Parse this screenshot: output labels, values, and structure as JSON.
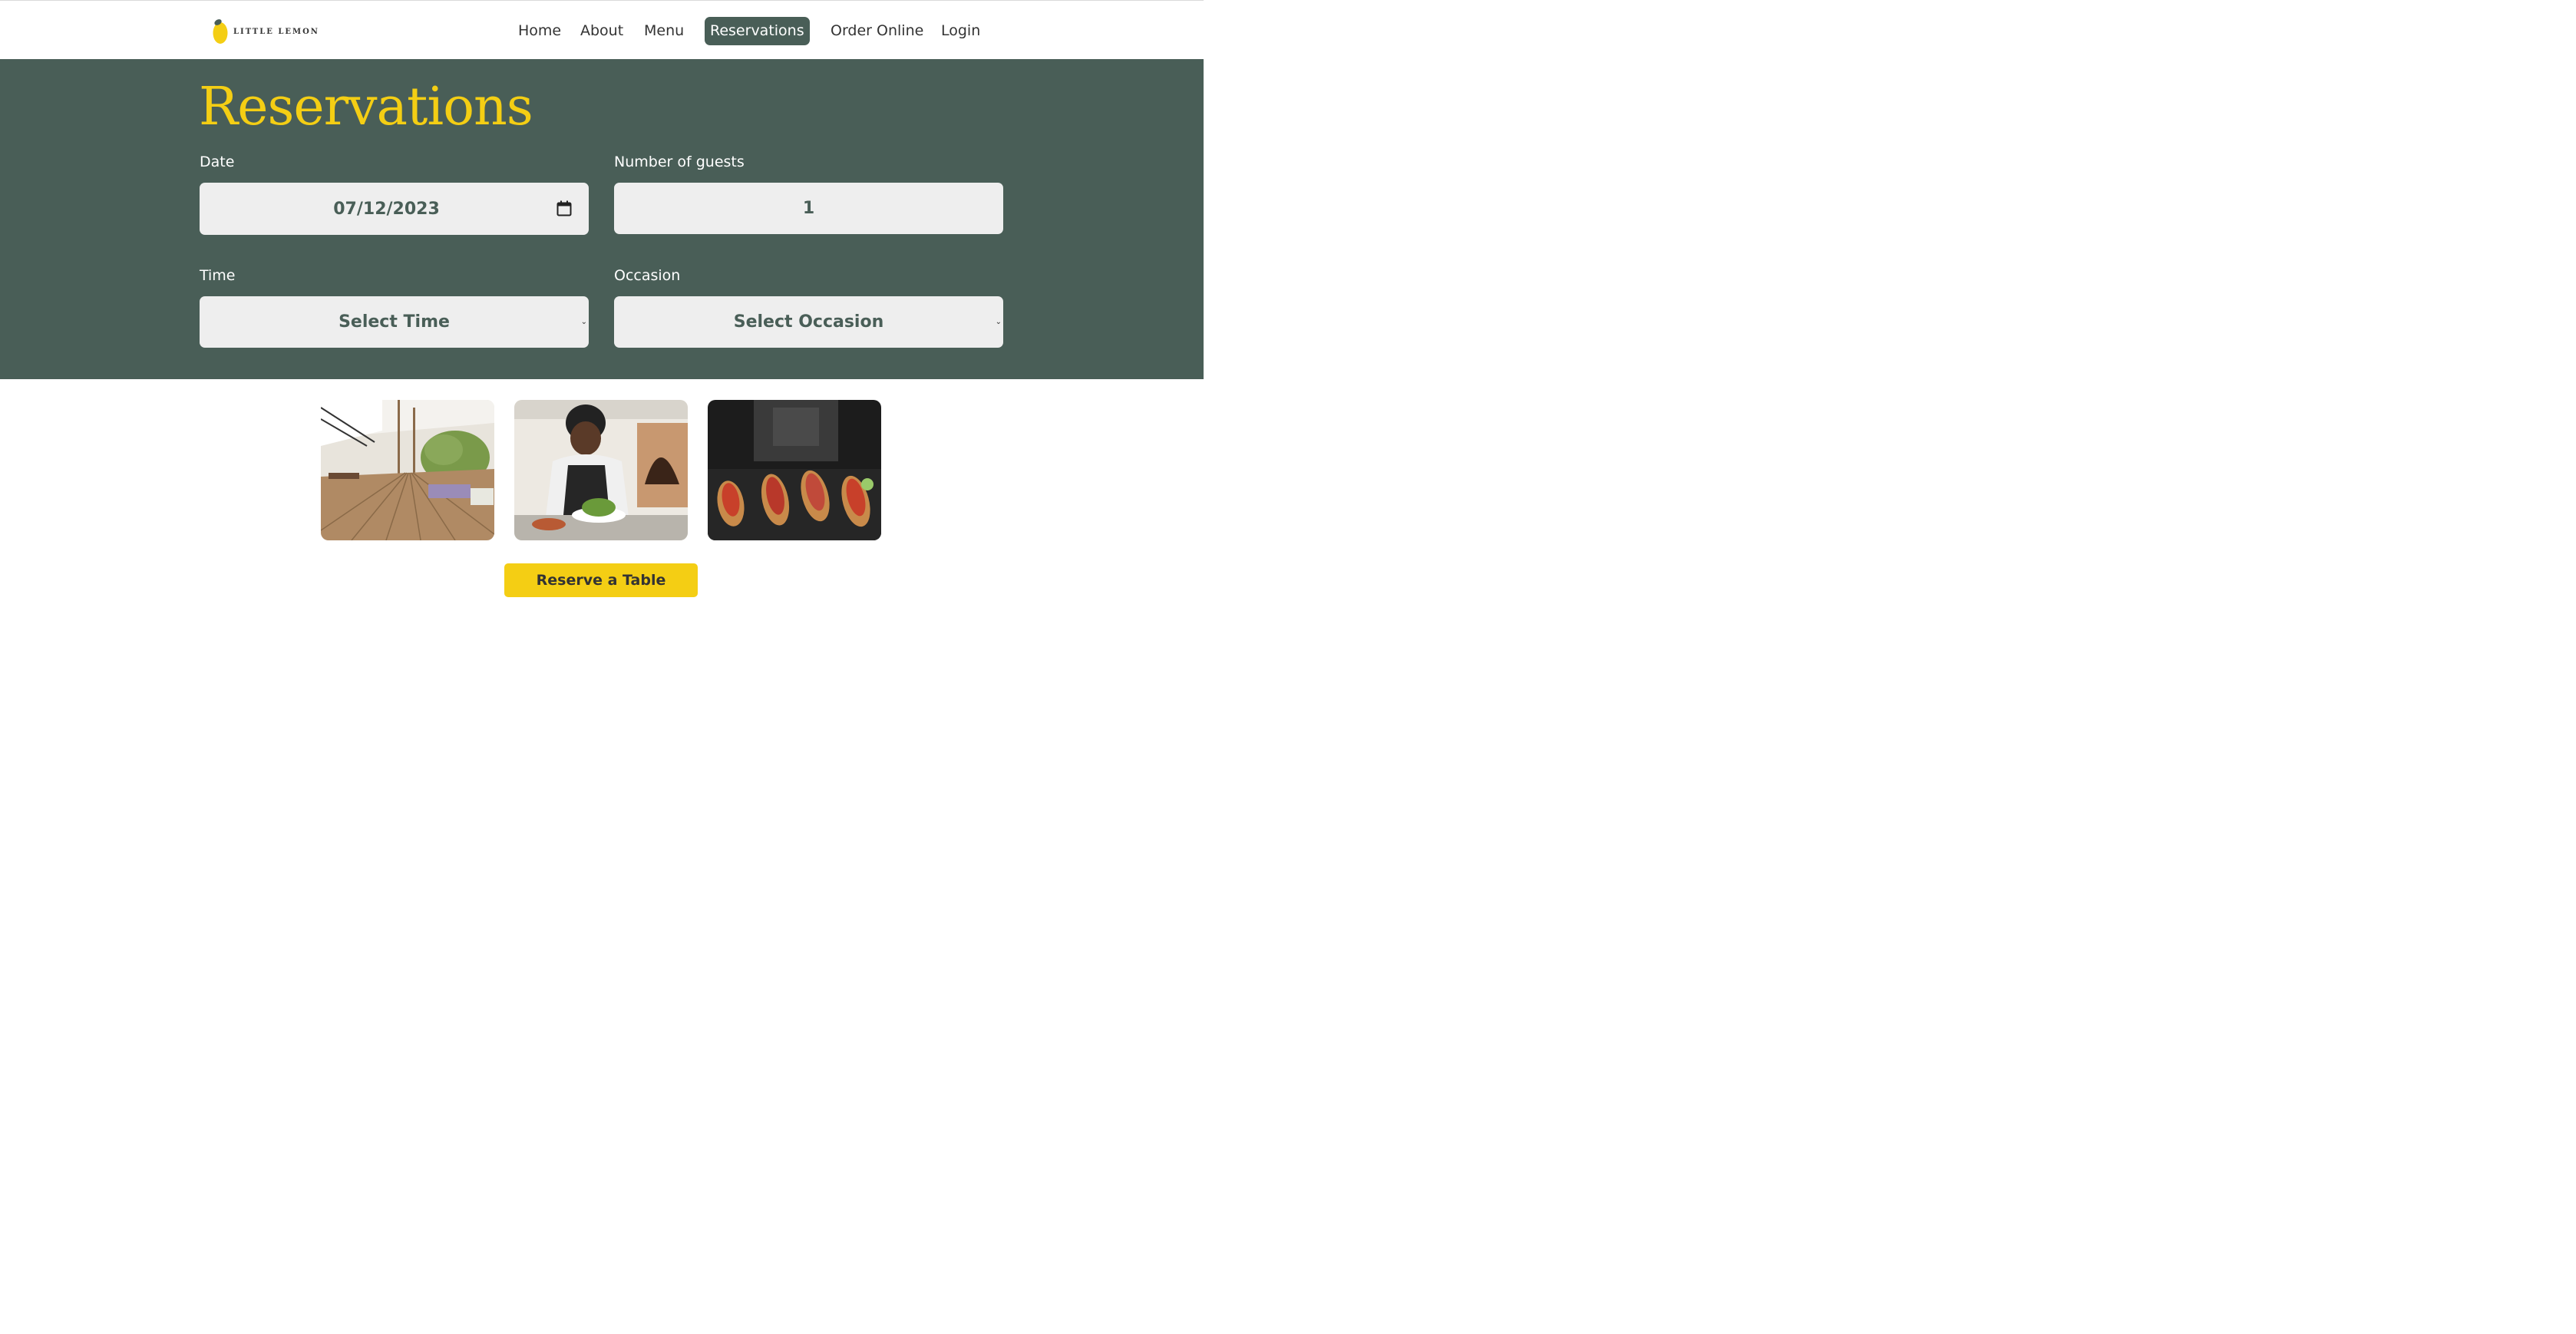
{
  "brand": {
    "name": "LITTLE LEMON"
  },
  "nav": {
    "items": [
      {
        "label": "Home"
      },
      {
        "label": "About"
      },
      {
        "label": "Menu"
      },
      {
        "label": "Reservations",
        "active": true
      },
      {
        "label": "Order Online"
      },
      {
        "label": "Login"
      }
    ]
  },
  "page": {
    "title": "Reservations"
  },
  "form": {
    "date": {
      "label": "Date",
      "value": "07/12/2023"
    },
    "guests": {
      "label": "Number of guests",
      "value": "1"
    },
    "time": {
      "label": "Time",
      "selected": "Select Time"
    },
    "occasion": {
      "label": "Occasion",
      "selected": "Select Occasion"
    }
  },
  "photos": [
    {
      "subject": "restaurant-interior"
    },
    {
      "subject": "chef-plating"
    },
    {
      "subject": "bruschetta"
    }
  ],
  "cta": {
    "label": "Reserve a Table"
  },
  "colors": {
    "primary_green": "#495e57",
    "primary_yellow": "#f4ce14",
    "field_bg": "#eeeeee"
  },
  "icons": {
    "date": "calendar-icon",
    "select": "chevron-down-icon"
  }
}
